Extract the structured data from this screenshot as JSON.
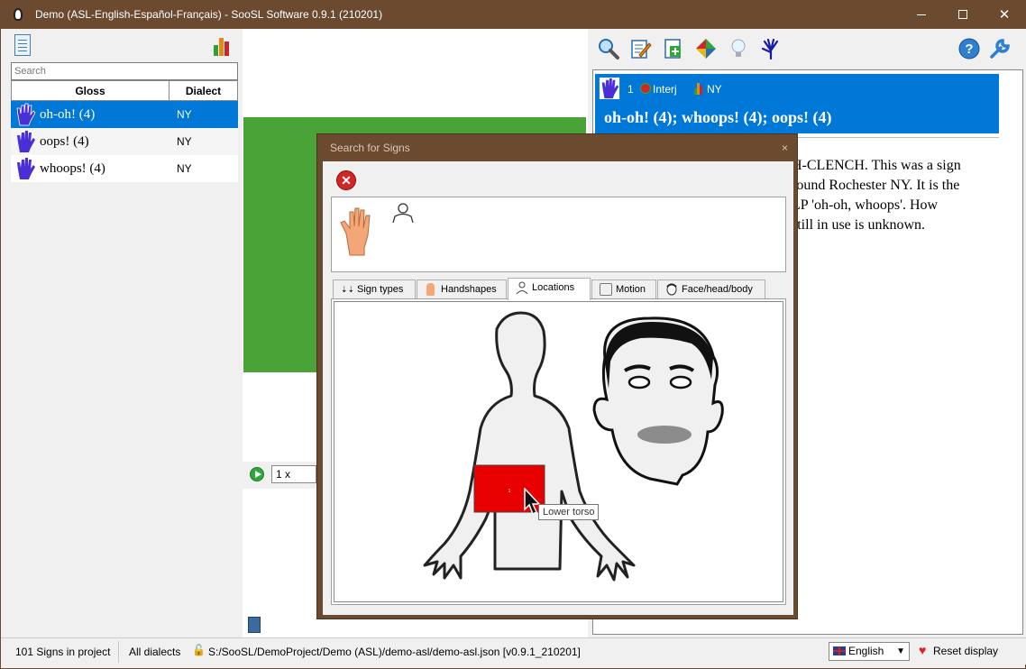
{
  "window": {
    "title": "Demo (ASL-English-Español-Français) - SooSL Software 0.9.1 (210201)"
  },
  "left_panel": {
    "search_placeholder": "Search",
    "columns": {
      "gloss": "Gloss",
      "dialect": "Dialect"
    },
    "rows": [
      {
        "gloss": "oh-oh! (4)",
        "dialect": "NY",
        "selected": true
      },
      {
        "gloss": "oops! (4)",
        "dialect": "NY",
        "selected": false
      },
      {
        "gloss": "whoops! (4)",
        "dialect": "NY",
        "selected": false
      }
    ]
  },
  "player": {
    "speed": "1 x"
  },
  "sense": {
    "number": "1",
    "part_of_speech": "Interj",
    "dialect": "NY",
    "gloss_line": "oh-oh! (4); whoops! (4); oops! (4)",
    "notes": "H-CLENCH. This was a sign ound Rochester NY. It is the LP 'oh-oh, whoops'. How still in use is unknown.",
    "notes_lines": [
      "H-CLENCH. This was a sign",
      "round Rochester NY. It is the",
      "LP 'oh-oh, whoops'. How",
      "still in use is unknown."
    ]
  },
  "dialog": {
    "title": "Search for Signs",
    "close": "×",
    "tabs": [
      {
        "label": "Sign types",
        "icon": "sign-types-icon"
      },
      {
        "label": "Handshapes",
        "icon": "handshape-icon"
      },
      {
        "label": "Locations",
        "icon": "location-icon",
        "active": true
      },
      {
        "label": "Motion",
        "icon": "motion-icon"
      },
      {
        "label": "Face/head/body",
        "icon": "face-icon"
      }
    ],
    "body_region_number": "1",
    "tooltip": "Lower torso"
  },
  "status": {
    "sign_count": "101 Signs in project",
    "dialects": "All dialects",
    "path": "S:/SooSL/DemoProject/Demo (ASL)/demo-asl/demo-asl.json [v0.9.1_210201]",
    "language": "English",
    "reset": "Reset display"
  },
  "colors": {
    "titlebar": "#6b4a30",
    "selection": "#0078d7",
    "highlight_region": "#e00000",
    "video": "#4aa336"
  }
}
